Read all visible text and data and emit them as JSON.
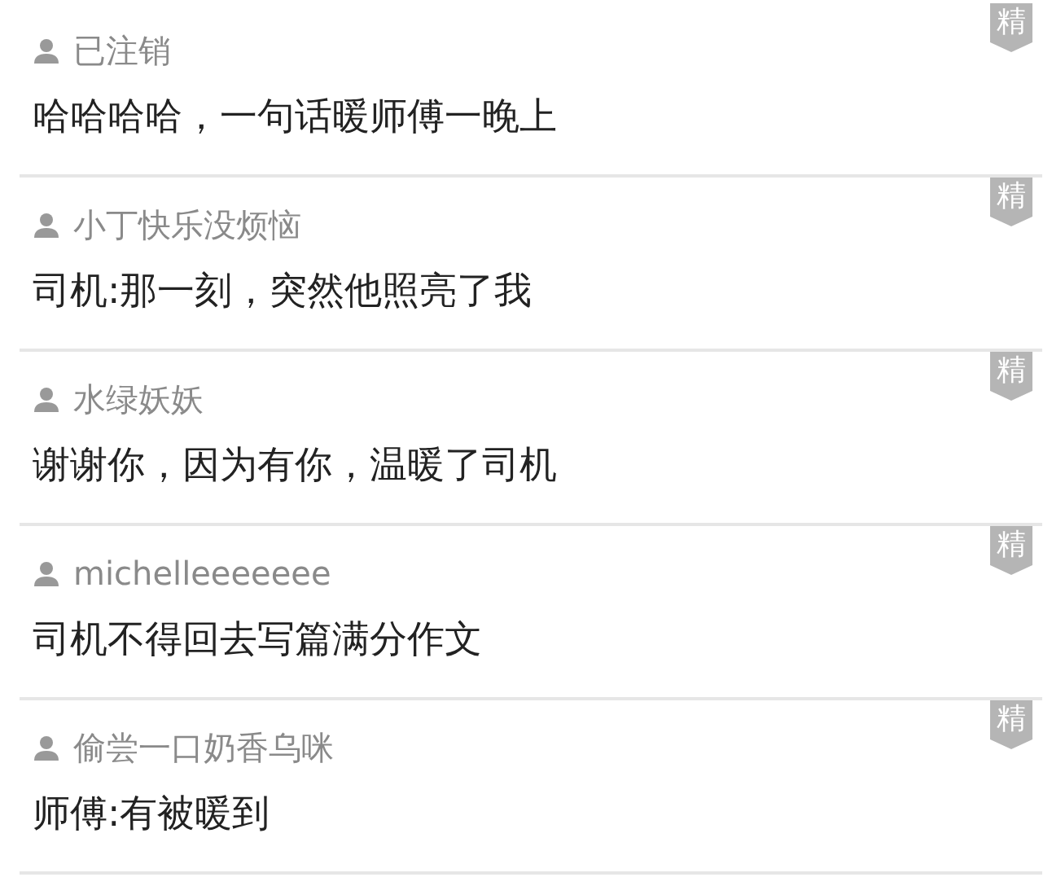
{
  "comments": [
    {
      "user": "已注销",
      "text": "哈哈哈哈，一句话暖师傅一晚上",
      "badge": "精"
    },
    {
      "user": "小丁快乐没烦恼",
      "text": "司机:那一刻，突然他照亮了我",
      "badge": "精"
    },
    {
      "user": "水绿妖妖",
      "text": "谢谢你，因为有你，温暖了司机",
      "badge": "精"
    },
    {
      "user": "michelleeeeeee",
      "text": "司机不得回去写篇满分作文",
      "badge": "精"
    },
    {
      "user": "偷尝一口奶香乌咪",
      "text": "师傅:有被暖到",
      "badge": "精"
    }
  ]
}
